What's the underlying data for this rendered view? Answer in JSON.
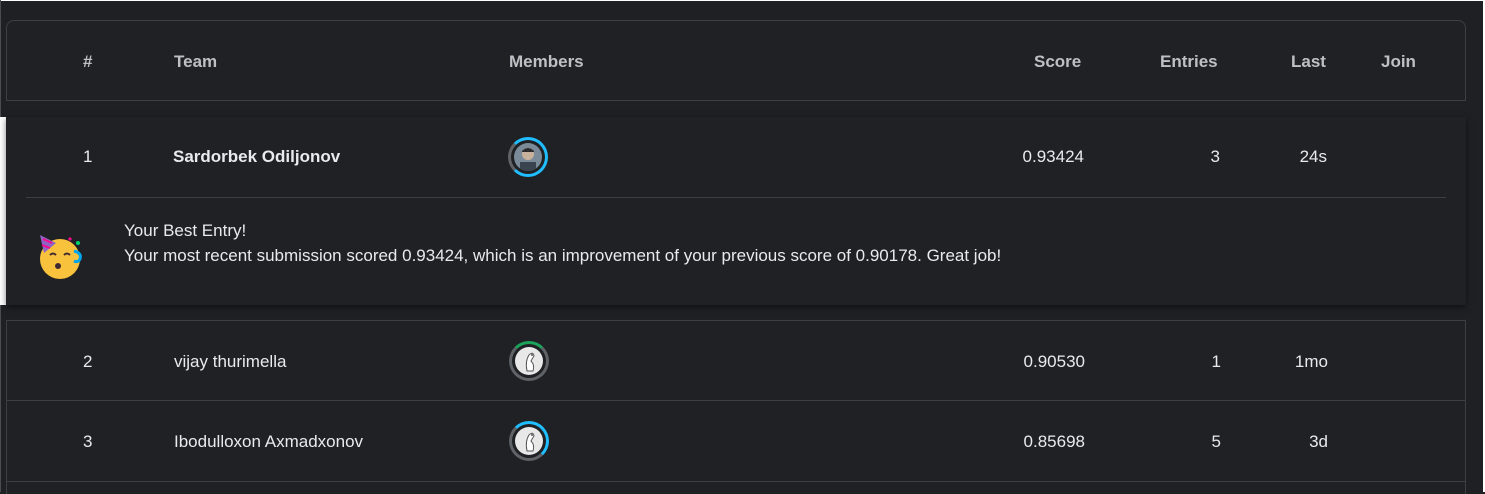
{
  "header": {
    "rank": "#",
    "team": "Team",
    "members": "Members",
    "score": "Score",
    "entries": "Entries",
    "last": "Last",
    "join": "Join"
  },
  "rows": [
    {
      "rank": "1",
      "team": "Sardorbek Odiljonov",
      "score": "0.93424",
      "entries": "3",
      "last": "24s",
      "avatar_ring": "#20beff"
    },
    {
      "rank": "2",
      "team": "vijay thurimella",
      "score": "0.90530",
      "entries": "1",
      "last": "1mo",
      "avatar_ring": "#1ba35b"
    },
    {
      "rank": "3",
      "team": "Ibodulloxon Axmadxonov",
      "score": "0.85698",
      "entries": "5",
      "last": "3d",
      "avatar_ring": "#20beff"
    }
  ],
  "best_entry": {
    "icon": "partying-face-icon",
    "title": "Your Best Entry!",
    "message": "Your most recent submission scored 0.93424, which is an improvement of your previous score of 0.90178. Great job!"
  },
  "colors": {
    "background": "#1f2024",
    "border": "#3c4043",
    "accent": "#20beff"
  }
}
